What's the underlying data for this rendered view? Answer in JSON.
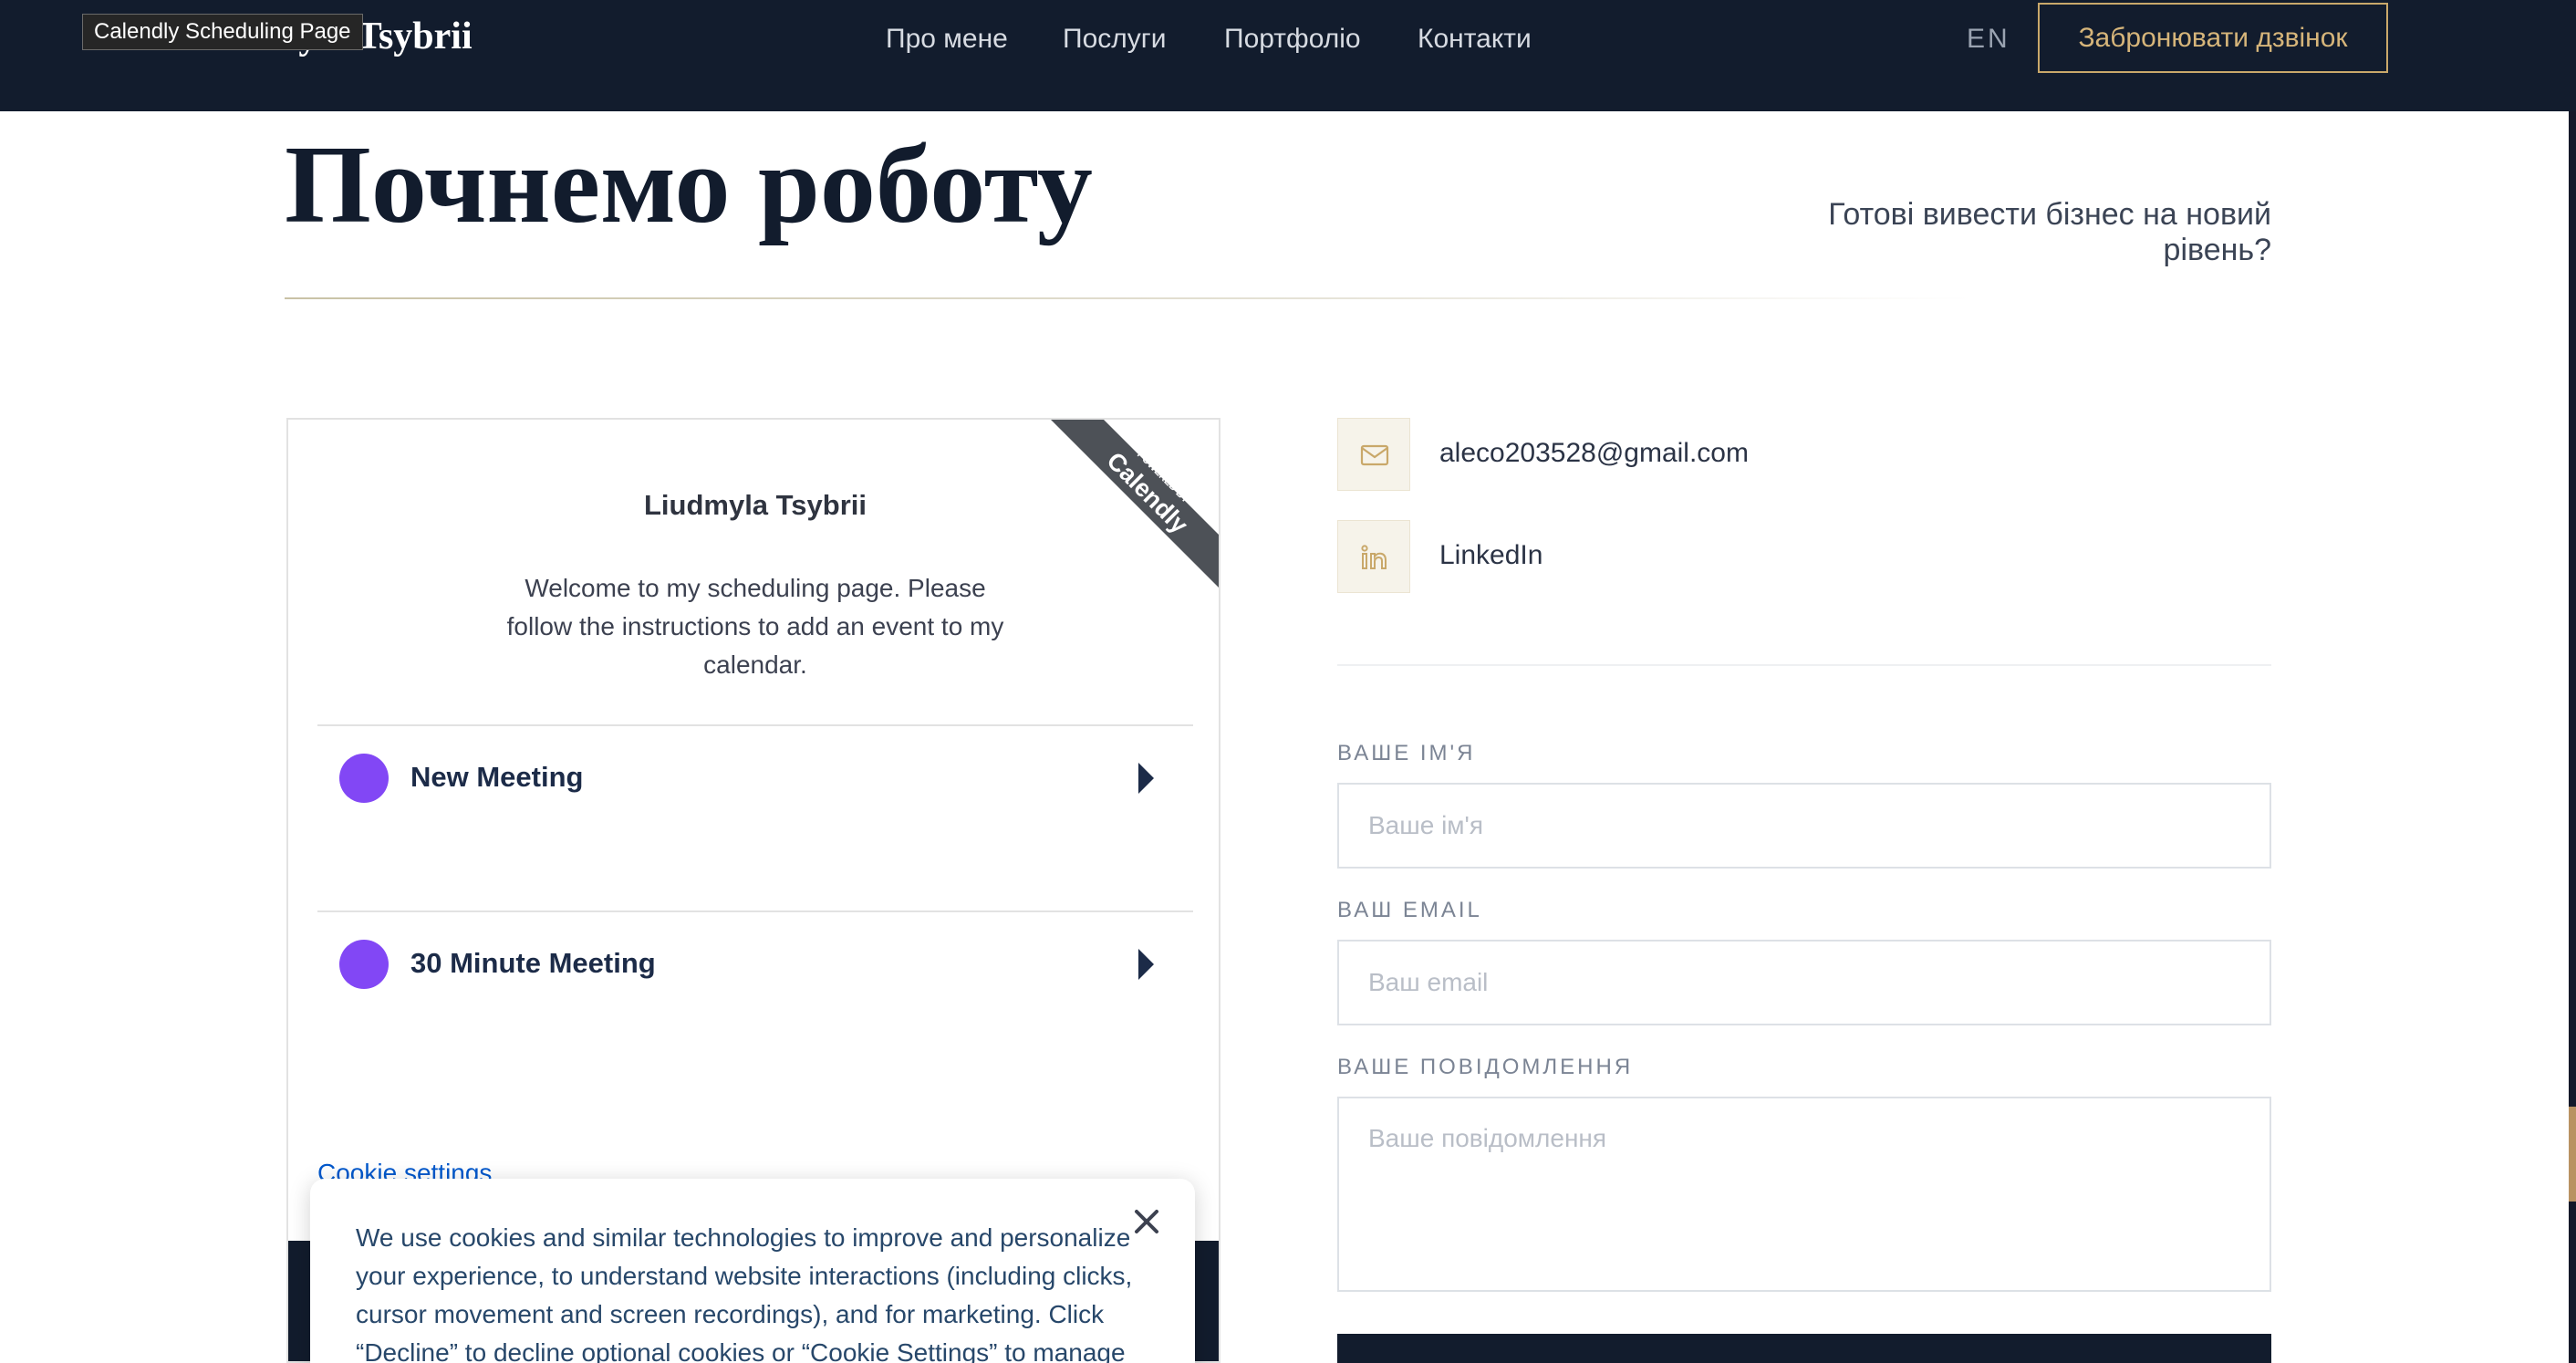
{
  "tooltip": "Calendly Scheduling Page",
  "header": {
    "brand": "Liudmyla Tsybrii",
    "nav": [
      "Про мене",
      "Послуги",
      "Портфоліо",
      "Контакти"
    ],
    "lang": "EN",
    "cta": "Забронювати дзвінок"
  },
  "hero": {
    "title": "Почнемо роботу",
    "tagline": "Готові вивести бізнес на новий рівень?"
  },
  "calendly": {
    "ribbon_small": "POWERED BY",
    "ribbon_brand": "Calendly",
    "name": "Liudmyla Tsybrii",
    "welcome": "Welcome to my scheduling page. Please follow the instructions to add an event to my calendar.",
    "events": [
      {
        "name": "New Meeting",
        "color": "#8247f5"
      },
      {
        "name": "30 Minute Meeting",
        "color": "#8247f5"
      }
    ],
    "cookie_settings": "Cookie settings",
    "cookie_banner": "We use cookies and similar technologies to improve and personalize your experience, to understand website interactions (including clicks, cursor movement and screen recordings), and for marketing. Click “Decline” to decline optional cookies or “Cookie Settings” to manage"
  },
  "contact": {
    "email": "aleco203528@gmail.com",
    "linkedin": "LinkedIn"
  },
  "form": {
    "name_label": "ВАШЕ ІМ'Я",
    "name_placeholder": "Ваше ім'я",
    "email_label": "ВАШ EMAIL",
    "email_placeholder": "Ваш email",
    "message_label": "ВАШЕ ПОВІДОМЛЕННЯ",
    "message_placeholder": "Ваше повідомлення"
  },
  "colors": {
    "navy": "#121c2d",
    "gold": "#c9a86a",
    "event_purple": "#8247f5",
    "link_blue": "#0058cc"
  }
}
